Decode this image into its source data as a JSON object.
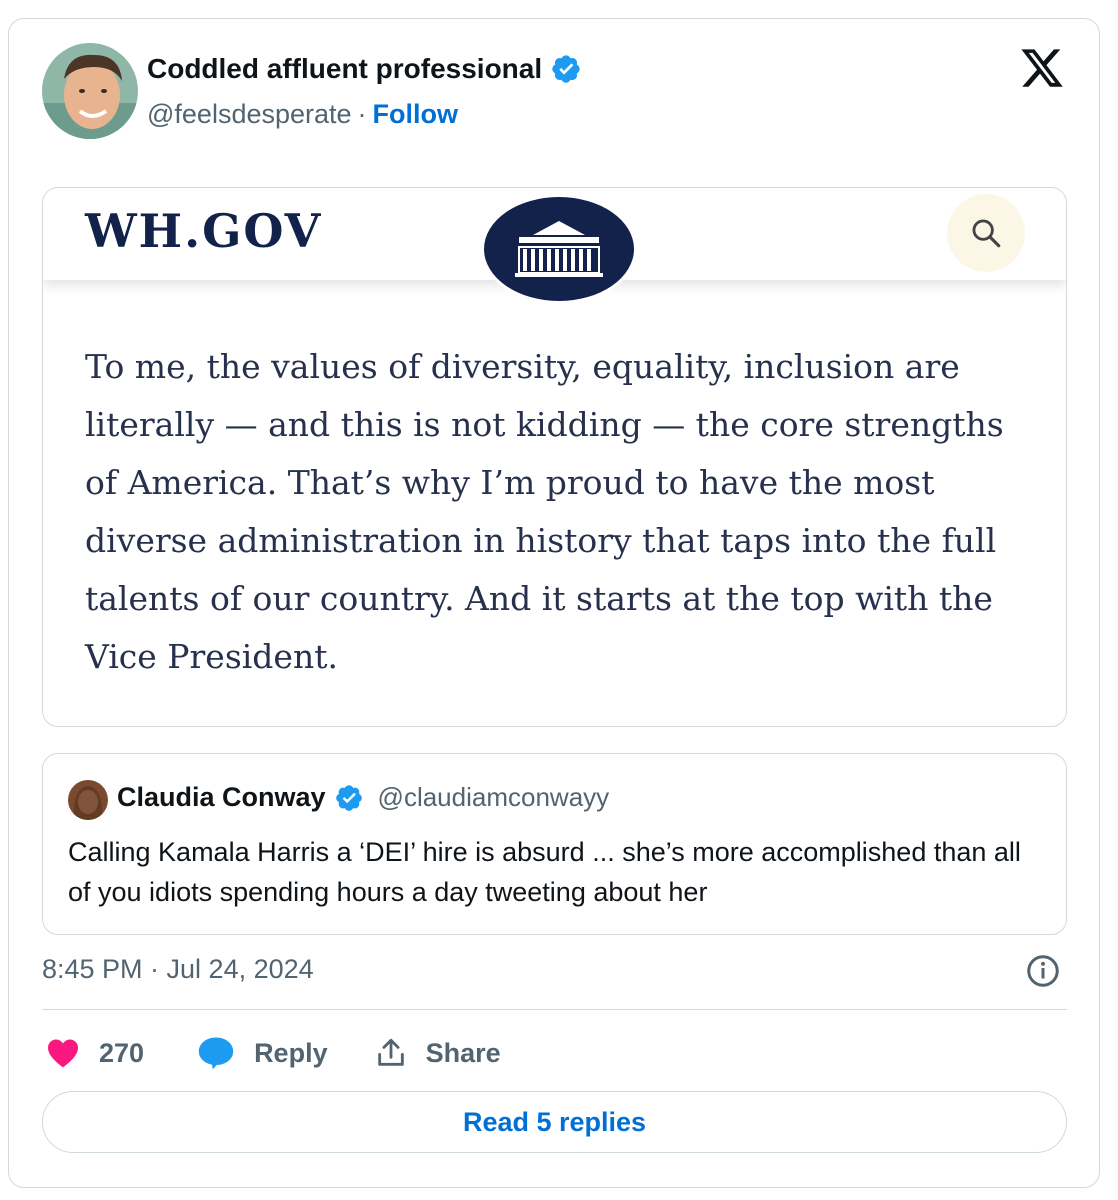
{
  "tweet": {
    "author": {
      "display_name": "Coddled affluent professional",
      "handle": "@feelsdesperate",
      "separator": "·",
      "follow_label": "Follow",
      "verified": true
    },
    "embed": {
      "site_title": "WH.GOV",
      "quote_text": "To me, the values of diversity, equality, inclusion are literally — and this is not kidding — the core strengths of America. That’s why I’m proud to have the most diverse administration in history that taps into the full talents of our country. And it starts at the top with the Vice President."
    },
    "quoted_tweet": {
      "display_name": "Claudia Conway",
      "handle": "@claudiamconwayy",
      "verified": true,
      "text": "Calling Kamala Harris a ‘DEI’ hire is absurd ... she’s more accomplished than all of you idiots spending hours a day tweeting about her"
    },
    "timestamp": "8:45 PM · Jul 24, 2024",
    "actions": {
      "like_count": "270",
      "reply_label": "Reply",
      "share_label": "Share"
    },
    "read_replies_label": "Read 5 replies"
  },
  "colors": {
    "link_blue": "#006fd6",
    "verified_blue": "#1d9bf0",
    "heart_pink": "#f91880",
    "reply_blue": "#1d9bf0",
    "wh_navy": "#13224a"
  },
  "icons": [
    "verified-badge-icon",
    "x-logo-icon",
    "search-icon",
    "white-house-seal-icon",
    "heart-icon",
    "reply-bubble-icon",
    "share-icon",
    "info-icon"
  ]
}
